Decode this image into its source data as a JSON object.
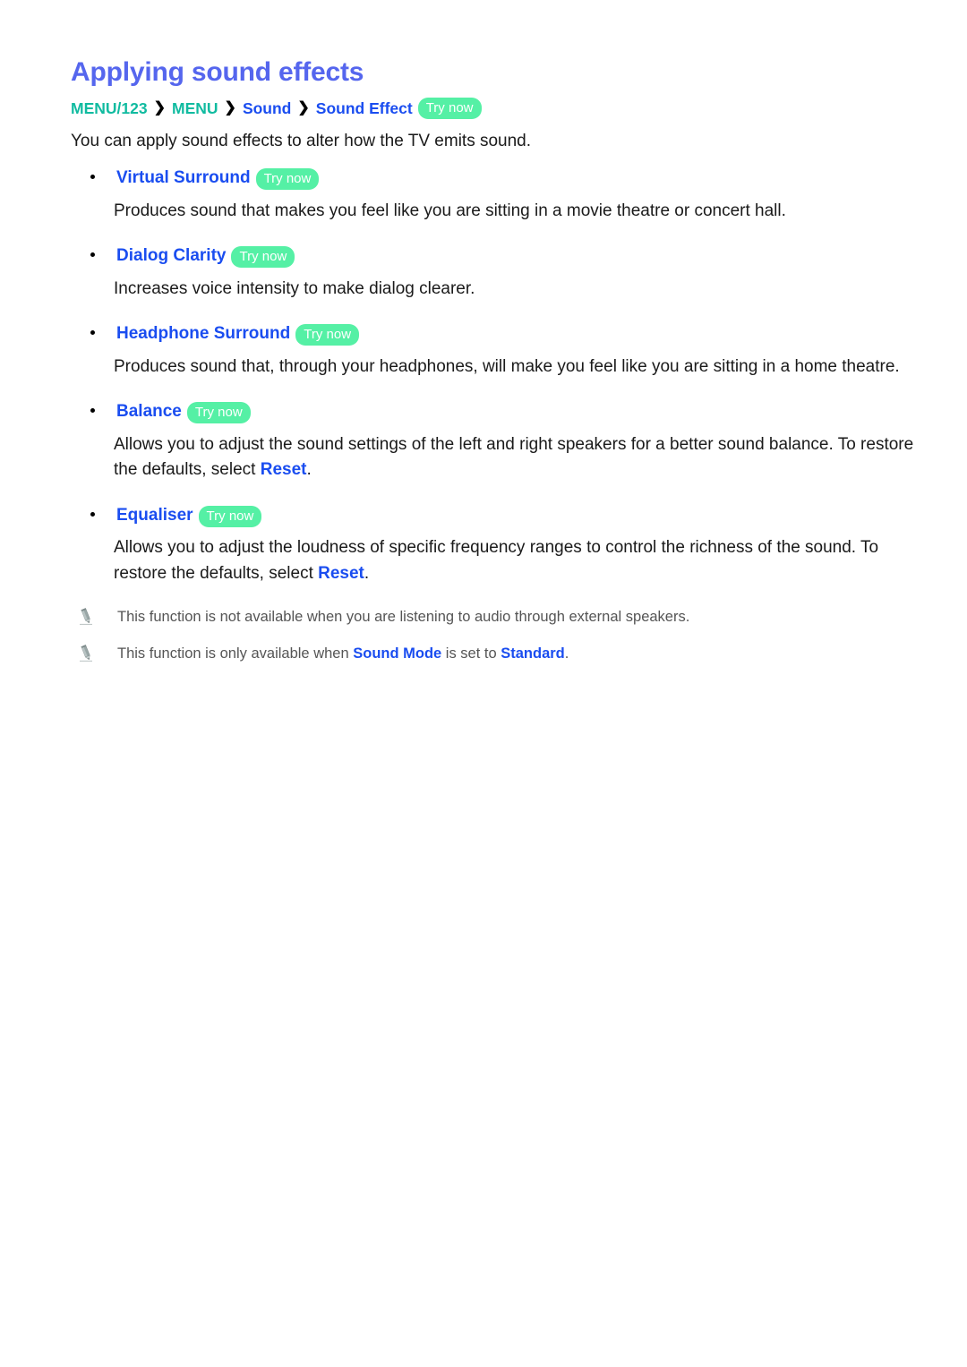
{
  "page": {
    "title": "Applying sound effects"
  },
  "breadcrumb": {
    "items": [
      {
        "label": "MENU/123",
        "color": "teal"
      },
      {
        "label": "MENU",
        "color": "teal"
      },
      {
        "label": "Sound",
        "color": "blue"
      },
      {
        "label": "Sound Effect",
        "color": "blue"
      }
    ],
    "separator": "❯",
    "badge": "Try now"
  },
  "intro": "You can apply sound effects to alter how the TV emits sound.",
  "items": [
    {
      "title": "Virtual Surround",
      "badge": "Try now",
      "desc_before": "Produces sound that makes you feel like you are sitting in a movie theatre or concert hall.",
      "desc_link": "",
      "desc_after": ""
    },
    {
      "title": "Dialog Clarity",
      "badge": "Try now",
      "desc_before": "Increases voice intensity to make dialog clearer.",
      "desc_link": "",
      "desc_after": ""
    },
    {
      "title": "Headphone Surround",
      "badge": "Try now",
      "desc_before": "Produces sound that, through your headphones, will make you feel like you are sitting in a home theatre.",
      "desc_link": "",
      "desc_after": ""
    },
    {
      "title": "Balance",
      "badge": "Try now",
      "desc_before": "Allows you to adjust the sound settings of the left and right speakers for a better sound balance. To restore the defaults, select ",
      "desc_link": "Reset",
      "desc_after": "."
    },
    {
      "title": "Equaliser",
      "badge": "Try now",
      "desc_before": "Allows you to adjust the loudness of specific frequency ranges to control the richness of the sound. To restore the defaults, select ",
      "desc_link": "Reset",
      "desc_after": "."
    }
  ],
  "notes": [
    {
      "icon": "pencil-icon",
      "text_before": "This function is not available when you are listening to audio through external speakers.",
      "link1": "",
      "text_middle": "",
      "link2": "",
      "text_after": ""
    },
    {
      "icon": "pencil-icon",
      "text_before": "This function is only available when ",
      "link1": "Sound Mode",
      "text_middle": " is set to ",
      "link2": "Standard",
      "text_after": "."
    }
  ],
  "colors": {
    "title": "#5566ee",
    "link_blue": "#1a4df0",
    "menu_teal": "#10bba0",
    "badge_green": "#55f0a5",
    "body_text": "#1a1a1a",
    "note_text": "#555555"
  }
}
